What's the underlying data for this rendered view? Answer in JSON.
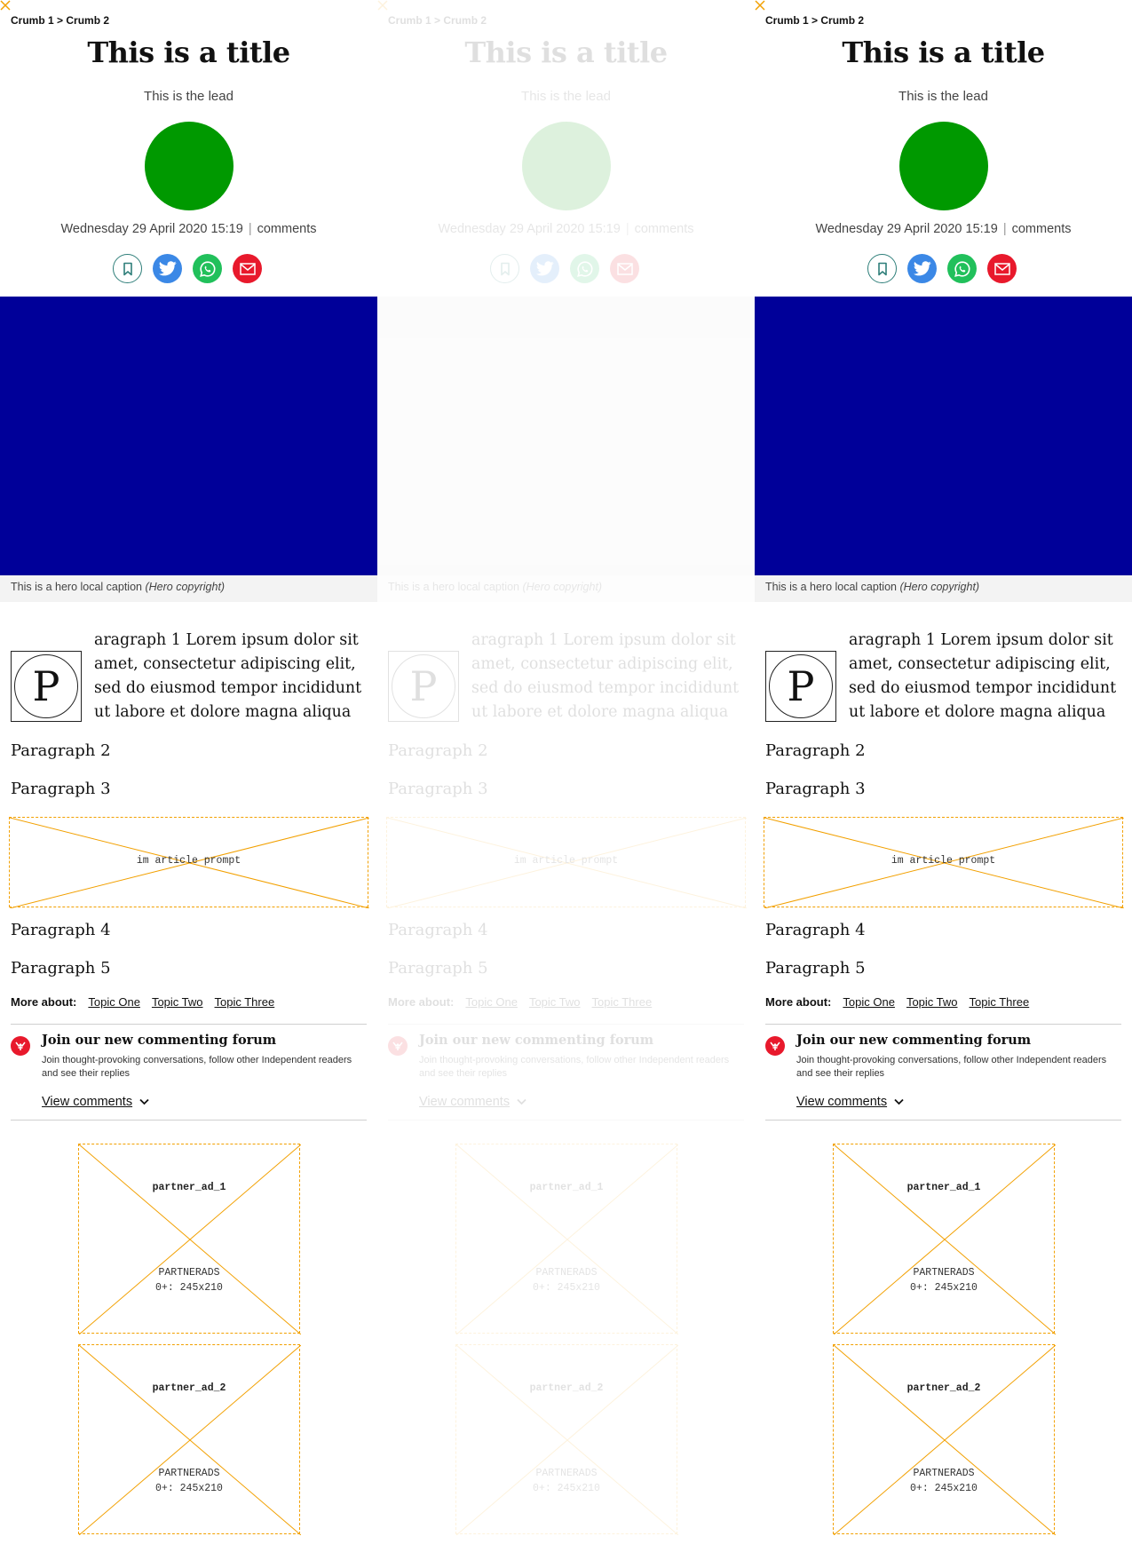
{
  "breadcrumb": {
    "crumb1": "Crumb 1",
    "separator": ">",
    "crumb2": "Crumb 2"
  },
  "article": {
    "title": "This is a title",
    "lead": "This is the lead",
    "date": "Wednesday 29 April 2020 15:19",
    "meta_separator": "|",
    "comments_link": "comments",
    "hero_caption": "This is a hero local caption",
    "hero_copyright": "(Hero copyright)",
    "dropcap_letter": "P",
    "paragraph1": "aragraph 1 Lorem ipsum dolor sit amet, consectetur adipiscing elit, sed do eiusmod tempor incididunt ut labore et dolore magna aliqua",
    "paragraph2": "Paragraph 2",
    "paragraph3": "Paragraph 3",
    "paragraph4": "Paragraph 4",
    "paragraph5": "Paragraph 5"
  },
  "colors": {
    "avatar": "#009900",
    "hero": "#000099",
    "bookmark": "#2f7f7a",
    "twitter": "#3b88e6",
    "whatsapp": "#21c05b",
    "email": "#e8192c",
    "placeholder": "#f2a000"
  },
  "share": {
    "icons": [
      "bookmark-icon",
      "twitter-icon",
      "whatsapp-icon",
      "email-icon"
    ]
  },
  "in_article_ad": {
    "label": "im article prompt"
  },
  "more_about": {
    "label": "More about:",
    "topics": [
      "Topic One",
      "Topic Two",
      "Topic Three"
    ]
  },
  "forum": {
    "title": "Join our new commenting forum",
    "subtitle": "Join thought-provoking conversations, follow other Independent readers and see their replies",
    "view_comments": "View comments"
  },
  "partner_ads": [
    {
      "name": "partner_ad_1",
      "label": "PARTNERADS",
      "size": "0+: 245x210"
    },
    {
      "name": "partner_ad_2",
      "label": "PARTNERADS",
      "size": "0+: 245x210"
    }
  ]
}
